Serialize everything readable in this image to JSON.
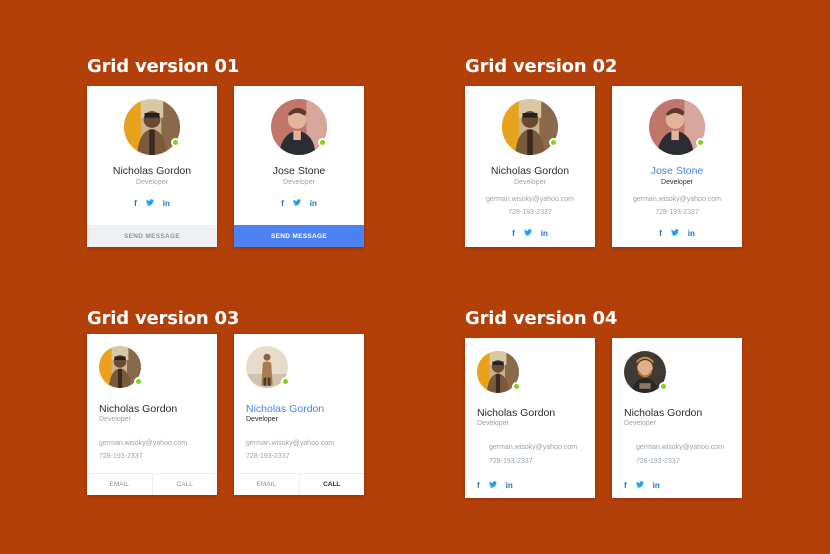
{
  "sections": [
    {
      "title": "Grid version 01"
    },
    {
      "title": "Grid version 02"
    },
    {
      "title": "Grid version 03"
    },
    {
      "title": "Grid version 04"
    }
  ],
  "grid1": {
    "card1": {
      "name": "Nicholas Gordon",
      "role": "Developer",
      "button": "SEND MESSAGE"
    },
    "card2": {
      "name": "Jose Stone",
      "role": "Developer",
      "button": "SEND MESSAGE"
    }
  },
  "grid2": {
    "card1": {
      "name": "Nicholas Gordon",
      "role": "Developer",
      "email": "german.wisoky@yahoo.com",
      "phone": "728-193-2337"
    },
    "card2": {
      "name": "Jose Stone",
      "role": "Developer",
      "email": "german.wisoky@yahoo.com",
      "phone": "728-193-2337"
    }
  },
  "grid3": {
    "card1": {
      "name": "Nicholas Gordon",
      "role": "Developer",
      "email": "german.wisoky@yahoo.com",
      "phone": "728-193-2337",
      "btn_email": "EMAIL",
      "btn_call": "CALL"
    },
    "card2": {
      "name": "Nicholas Gordon",
      "role": "Developer",
      "email": "german.wisoky@yahoo.com",
      "phone": "728-193-2337",
      "btn_email": "EMAIL",
      "btn_call": "CALL"
    }
  },
  "grid4": {
    "card1": {
      "name": "Nicholas Gordon",
      "role": "Developer",
      "email": "german.wisoky@yahoo.com",
      "phone": "728-193-2337"
    },
    "card2": {
      "name": "Nicholas Gordon",
      "role": "Developer",
      "email": "german.wisoky@yahoo.com",
      "phone": "728-193-2337"
    }
  },
  "social": {
    "facebook": "f",
    "twitter": "🐦",
    "linkedin": "in"
  },
  "colors": {
    "background": "#b33f09",
    "accent_blue": "#4c82f2",
    "status_online": "#7ed321",
    "muted_text": "#9aa3ad"
  }
}
